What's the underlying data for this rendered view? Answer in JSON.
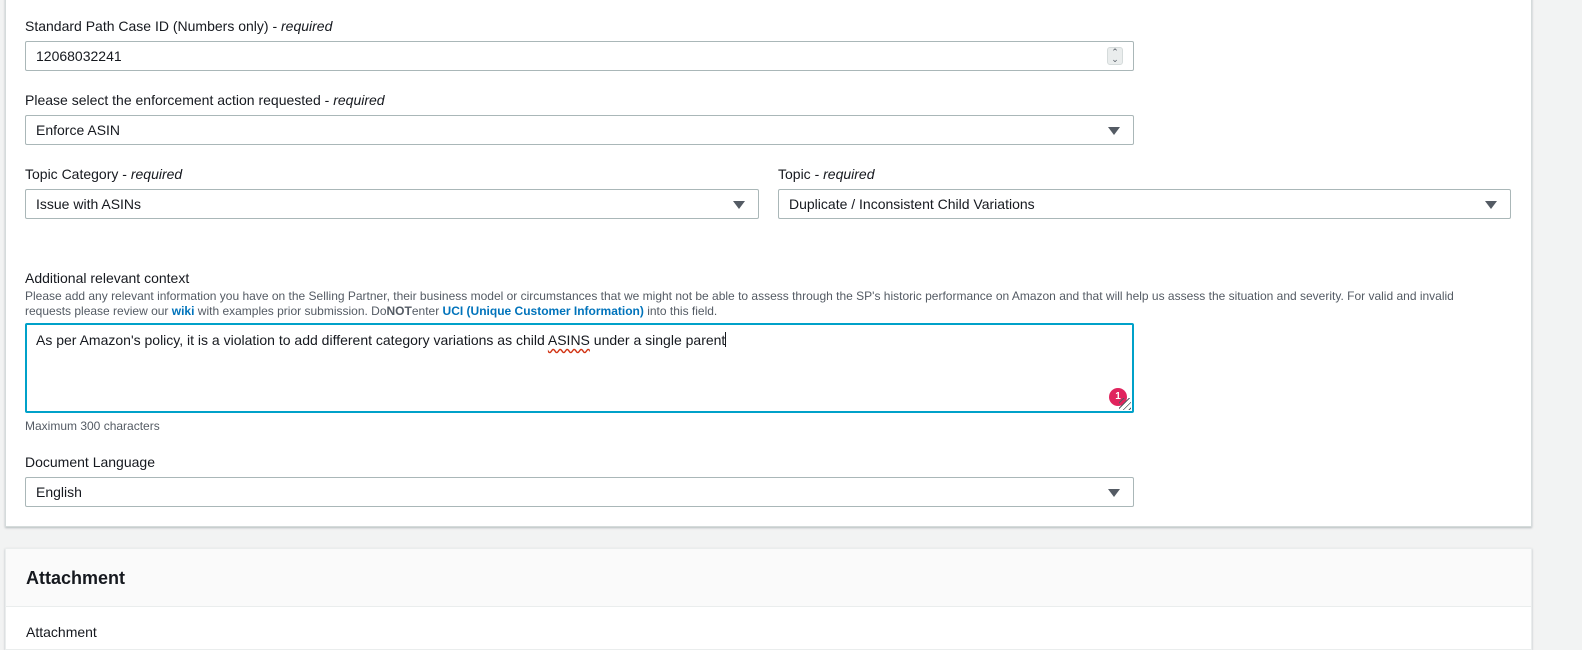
{
  "form": {
    "case_id": {
      "label": "Standard Path Case ID (Numbers only)",
      "required_sep": " - ",
      "required_text": "required",
      "value": "12068032241"
    },
    "enforcement": {
      "label": "Please select the enforcement action requested",
      "required_sep": " - ",
      "required_text": "required",
      "value": "Enforce ASIN"
    },
    "topic_category": {
      "label": "Topic Category",
      "required_sep": " - ",
      "required_text": "required",
      "value": "Issue with ASINs"
    },
    "topic": {
      "label": "Topic",
      "required_sep": " - ",
      "required_text": "required",
      "value": "Duplicate / Inconsistent Child Variations"
    },
    "context": {
      "label": "Additional relevant context",
      "description_1": "Please add any relevant information you have on the Selling Partner, their business model or circumstances that we might not be able to assess through the SP's historic performance on Amazon and that will help us assess the situation and severity. For valid and invalid requests please review our ",
      "wiki_link": "wiki",
      "description_2": " with examples prior submission. Do",
      "not_text": "NOT",
      "description_3": "enter ",
      "uci_link": "UCI (Unique Customer Information)",
      "description_4": " into this field.",
      "value_before": "As per Amazon's policy, it is a violation to add different category variations as child ",
      "value_misspelled": "ASINS",
      "value_after": " under a single parent",
      "badge_count": "1",
      "hint": "Maximum 300 characters"
    },
    "language": {
      "label": "Document Language",
      "value": "English"
    }
  },
  "attachment": {
    "title": "Attachment",
    "field_label": "Attachment"
  },
  "colors": {
    "focus_border": "#00a1c9",
    "link": "#0073bb",
    "badge": "#e0245e",
    "spell_underline": "#d13212"
  }
}
